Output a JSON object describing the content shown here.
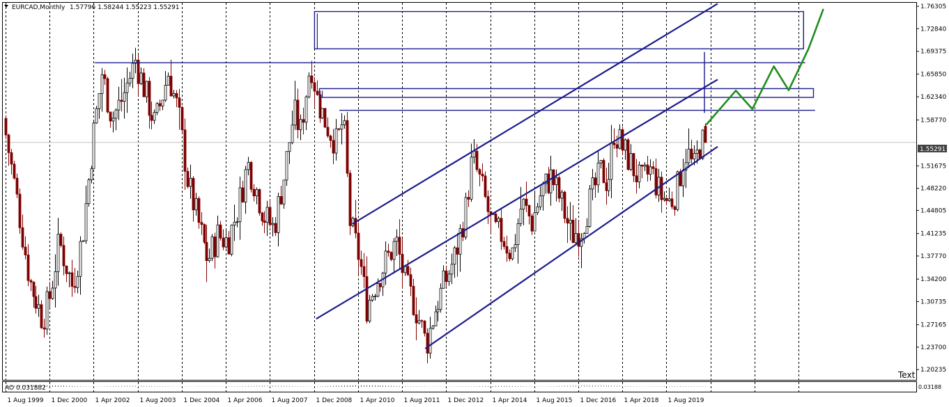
{
  "header": {
    "symbol": "EURCAD,Monthly",
    "ohlc": "1.57796 1.58244 1.55223 1.55291"
  },
  "indicator": {
    "label": "AO 0.031882",
    "right_readout": "0.03188"
  },
  "corner_label": "Text",
  "price_tag": "1.55291",
  "colors": {
    "bull": "#000000",
    "bear": "#7f0000",
    "channel": "#1a1a8c",
    "projection": "#1e8c1e",
    "grid": "#000000",
    "tag_bg": "#404040"
  },
  "chart_data": {
    "type": "candlestick",
    "title": "EURCAD,Monthly",
    "timeframe": "Monthly",
    "last_ohlc": {
      "open": 1.57796,
      "high": 1.58244,
      "low": 1.55223,
      "close": 1.55291
    },
    "ylim": [
      1.1865,
      1.7685
    ],
    "y_ticks": [
      "1.76305",
      "1.72840",
      "1.69375",
      "1.65850",
      "1.62340",
      "1.58770",
      "1.55291",
      "1.51675",
      "1.48220",
      "1.44805",
      "1.41235",
      "1.37770",
      "1.34200",
      "1.30735",
      "1.27165",
      "1.23700",
      "1.20235"
    ],
    "x_ticks": [
      "1 Aug 1999",
      "1 Dec 2000",
      "1 Apr 2002",
      "1 Aug 2003",
      "1 Dec 2004",
      "1 Apr 2006",
      "1 Aug 2007",
      "1 Dec 2008",
      "1 Apr 2010",
      "1 Aug 2011",
      "1 Dec 2012",
      "1 Apr 2014",
      "1 Aug 2015",
      "1 Dec 2016",
      "1 Apr 2018",
      "1 Aug 2019"
    ],
    "price_path": [
      [
        1999.6,
        1.59
      ],
      [
        2000.0,
        1.47
      ],
      [
        2000.4,
        1.34
      ],
      [
        2000.8,
        1.28
      ],
      [
        2001.0,
        1.31
      ],
      [
        2001.3,
        1.4
      ],
      [
        2001.7,
        1.33
      ],
      [
        2002.0,
        1.41
      ],
      [
        2002.3,
        1.55
      ],
      [
        2002.6,
        1.66
      ],
      [
        2002.9,
        1.59
      ],
      [
        2003.2,
        1.62
      ],
      [
        2003.6,
        1.68
      ],
      [
        2003.9,
        1.63
      ],
      [
        2004.2,
        1.58
      ],
      [
        2004.6,
        1.66
      ],
      [
        2004.9,
        1.6
      ],
      [
        2005.2,
        1.49
      ],
      [
        2005.5,
        1.43
      ],
      [
        2005.8,
        1.37
      ],
      [
        2006.1,
        1.41
      ],
      [
        2006.4,
        1.4
      ],
      [
        2006.7,
        1.45
      ],
      [
        2007.0,
        1.52
      ],
      [
        2007.2,
        1.49
      ],
      [
        2007.5,
        1.44
      ],
      [
        2007.8,
        1.42
      ],
      [
        2008.1,
        1.5
      ],
      [
        2008.4,
        1.6
      ],
      [
        2008.6,
        1.57
      ],
      [
        2008.9,
        1.68
      ],
      [
        2009.1,
        1.62
      ],
      [
        2009.4,
        1.58
      ],
      [
        2009.7,
        1.55
      ],
      [
        2009.9,
        1.59
      ],
      [
        2010.1,
        1.43
      ],
      [
        2010.4,
        1.37
      ],
      [
        2010.6,
        1.3
      ],
      [
        2010.9,
        1.34
      ],
      [
        2011.2,
        1.37
      ],
      [
        2011.5,
        1.4
      ],
      [
        2011.8,
        1.33
      ],
      [
        2012.0,
        1.31
      ],
      [
        2012.3,
        1.26
      ],
      [
        2012.4,
        1.24
      ],
      [
        2012.7,
        1.3
      ],
      [
        2013.0,
        1.34
      ],
      [
        2013.3,
        1.38
      ],
      [
        2013.6,
        1.45
      ],
      [
        2013.8,
        1.53
      ],
      [
        2014.1,
        1.48
      ],
      [
        2014.4,
        1.42
      ],
      [
        2014.7,
        1.41
      ],
      [
        2015.0,
        1.38
      ],
      [
        2015.3,
        1.46
      ],
      [
        2015.6,
        1.43
      ],
      [
        2015.9,
        1.48
      ],
      [
        2016.2,
        1.5
      ],
      [
        2016.5,
        1.46
      ],
      [
        2016.8,
        1.41
      ],
      [
        2017.1,
        1.42
      ],
      [
        2017.4,
        1.47
      ],
      [
        2017.7,
        1.51
      ],
      [
        2017.9,
        1.49
      ],
      [
        2018.1,
        1.57
      ],
      [
        2018.4,
        1.54
      ],
      [
        2018.7,
        1.51
      ],
      [
        2018.9,
        1.49
      ],
      [
        2019.2,
        1.51
      ],
      [
        2019.5,
        1.47
      ],
      [
        2019.8,
        1.46
      ],
      [
        2020.0,
        1.48
      ],
      [
        2020.2,
        1.53
      ],
      [
        2020.3,
        1.54
      ],
      [
        2020.5,
        1.51
      ],
      [
        2020.7,
        1.55291
      ]
    ],
    "channel_lines": [
      {
        "role": "upper",
        "from": [
          2010.1,
          1.4273
        ],
        "to": [
          2021.15,
          1.7671
        ]
      },
      {
        "role": "middle",
        "from": [
          2009.0,
          1.2806
        ],
        "to": [
          2021.15,
          1.6501
        ]
      },
      {
        "role": "lower",
        "from": [
          2012.3,
          1.2348
        ],
        "to": [
          2021.15,
          1.5465
        ]
      }
    ],
    "resistance_boxes": [
      {
        "from": [
          2008.95,
          1.755
        ],
        "to": [
          2023.75,
          1.6975
        ]
      },
      {
        "from": [
          2009.1,
          1.636
        ],
        "to": [
          2024.05,
          1.6225
        ]
      }
    ],
    "resistance_lines": [
      {
        "price": 1.676,
        "from": 2002.3,
        "to": 2023.8
      },
      {
        "price": 1.6025,
        "from": 2009.7,
        "to": 2024.1
      }
    ],
    "vertical_markers": [
      {
        "x": 2020.75,
        "from": 1.6925,
        "to": 1.5985
      }
    ],
    "projection_path": [
      [
        2020.8,
        1.58
      ],
      [
        2021.7,
        1.633
      ],
      [
        2022.2,
        1.6045
      ],
      [
        2022.85,
        1.6705
      ],
      [
        2023.3,
        1.6335
      ],
      [
        2023.9,
        1.6975
      ],
      [
        2024.35,
        1.759
      ]
    ]
  }
}
